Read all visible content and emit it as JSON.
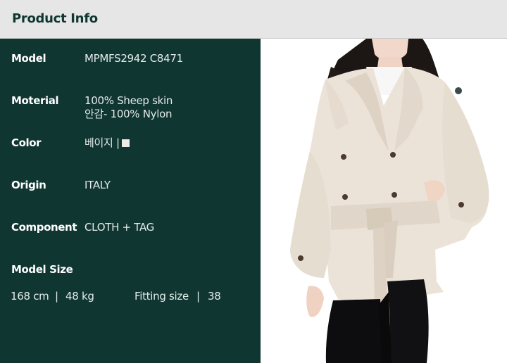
{
  "header": {
    "title": "Product Info"
  },
  "specs": [
    {
      "label": "Model",
      "value": "MPMFS2942 C8471"
    },
    {
      "label": "Moterial",
      "value": "100% Sheep skin",
      "value2": "안감- 100% Nylon"
    },
    {
      "label": "Color",
      "value": "베이지 |"
    },
    {
      "label": "Origin",
      "value": "ITALY"
    },
    {
      "label": "Component",
      "value": "CLOTH + TAG"
    }
  ],
  "model_size": {
    "label": "Model Size",
    "height": "168 cm",
    "weight": "48 kg",
    "fitting_label": "Fitting size",
    "fitting_value": "38",
    "separator": "|"
  },
  "colors": {
    "panel": "#103632",
    "header_bg": "#e6e6e6",
    "header_text": "#103732",
    "swatch": "#efebe6"
  }
}
